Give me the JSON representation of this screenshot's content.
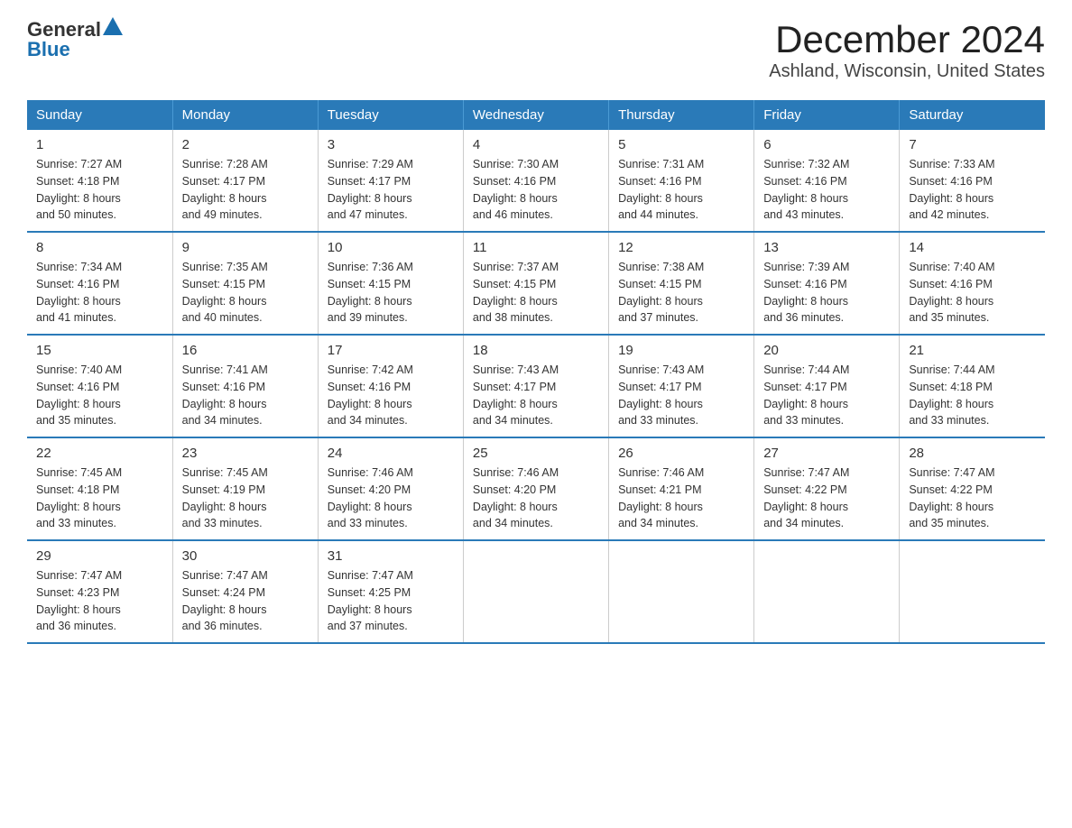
{
  "header": {
    "logo_general": "General",
    "logo_blue": "Blue",
    "month_title": "December 2024",
    "location": "Ashland, Wisconsin, United States"
  },
  "days_of_week": [
    "Sunday",
    "Monday",
    "Tuesday",
    "Wednesday",
    "Thursday",
    "Friday",
    "Saturday"
  ],
  "weeks": [
    [
      {
        "day": "1",
        "sunrise": "7:27 AM",
        "sunset": "4:18 PM",
        "daylight": "8 hours and 50 minutes."
      },
      {
        "day": "2",
        "sunrise": "7:28 AM",
        "sunset": "4:17 PM",
        "daylight": "8 hours and 49 minutes."
      },
      {
        "day": "3",
        "sunrise": "7:29 AM",
        "sunset": "4:17 PM",
        "daylight": "8 hours and 47 minutes."
      },
      {
        "day": "4",
        "sunrise": "7:30 AM",
        "sunset": "4:16 PM",
        "daylight": "8 hours and 46 minutes."
      },
      {
        "day": "5",
        "sunrise": "7:31 AM",
        "sunset": "4:16 PM",
        "daylight": "8 hours and 44 minutes."
      },
      {
        "day": "6",
        "sunrise": "7:32 AM",
        "sunset": "4:16 PM",
        "daylight": "8 hours and 43 minutes."
      },
      {
        "day": "7",
        "sunrise": "7:33 AM",
        "sunset": "4:16 PM",
        "daylight": "8 hours and 42 minutes."
      }
    ],
    [
      {
        "day": "8",
        "sunrise": "7:34 AM",
        "sunset": "4:16 PM",
        "daylight": "8 hours and 41 minutes."
      },
      {
        "day": "9",
        "sunrise": "7:35 AM",
        "sunset": "4:15 PM",
        "daylight": "8 hours and 40 minutes."
      },
      {
        "day": "10",
        "sunrise": "7:36 AM",
        "sunset": "4:15 PM",
        "daylight": "8 hours and 39 minutes."
      },
      {
        "day": "11",
        "sunrise": "7:37 AM",
        "sunset": "4:15 PM",
        "daylight": "8 hours and 38 minutes."
      },
      {
        "day": "12",
        "sunrise": "7:38 AM",
        "sunset": "4:15 PM",
        "daylight": "8 hours and 37 minutes."
      },
      {
        "day": "13",
        "sunrise": "7:39 AM",
        "sunset": "4:16 PM",
        "daylight": "8 hours and 36 minutes."
      },
      {
        "day": "14",
        "sunrise": "7:40 AM",
        "sunset": "4:16 PM",
        "daylight": "8 hours and 35 minutes."
      }
    ],
    [
      {
        "day": "15",
        "sunrise": "7:40 AM",
        "sunset": "4:16 PM",
        "daylight": "8 hours and 35 minutes."
      },
      {
        "day": "16",
        "sunrise": "7:41 AM",
        "sunset": "4:16 PM",
        "daylight": "8 hours and 34 minutes."
      },
      {
        "day": "17",
        "sunrise": "7:42 AM",
        "sunset": "4:16 PM",
        "daylight": "8 hours and 34 minutes."
      },
      {
        "day": "18",
        "sunrise": "7:43 AM",
        "sunset": "4:17 PM",
        "daylight": "8 hours and 34 minutes."
      },
      {
        "day": "19",
        "sunrise": "7:43 AM",
        "sunset": "4:17 PM",
        "daylight": "8 hours and 33 minutes."
      },
      {
        "day": "20",
        "sunrise": "7:44 AM",
        "sunset": "4:17 PM",
        "daylight": "8 hours and 33 minutes."
      },
      {
        "day": "21",
        "sunrise": "7:44 AM",
        "sunset": "4:18 PM",
        "daylight": "8 hours and 33 minutes."
      }
    ],
    [
      {
        "day": "22",
        "sunrise": "7:45 AM",
        "sunset": "4:18 PM",
        "daylight": "8 hours and 33 minutes."
      },
      {
        "day": "23",
        "sunrise": "7:45 AM",
        "sunset": "4:19 PM",
        "daylight": "8 hours and 33 minutes."
      },
      {
        "day": "24",
        "sunrise": "7:46 AM",
        "sunset": "4:20 PM",
        "daylight": "8 hours and 33 minutes."
      },
      {
        "day": "25",
        "sunrise": "7:46 AM",
        "sunset": "4:20 PM",
        "daylight": "8 hours and 34 minutes."
      },
      {
        "day": "26",
        "sunrise": "7:46 AM",
        "sunset": "4:21 PM",
        "daylight": "8 hours and 34 minutes."
      },
      {
        "day": "27",
        "sunrise": "7:47 AM",
        "sunset": "4:22 PM",
        "daylight": "8 hours and 34 minutes."
      },
      {
        "day": "28",
        "sunrise": "7:47 AM",
        "sunset": "4:22 PM",
        "daylight": "8 hours and 35 minutes."
      }
    ],
    [
      {
        "day": "29",
        "sunrise": "7:47 AM",
        "sunset": "4:23 PM",
        "daylight": "8 hours and 36 minutes."
      },
      {
        "day": "30",
        "sunrise": "7:47 AM",
        "sunset": "4:24 PM",
        "daylight": "8 hours and 36 minutes."
      },
      {
        "day": "31",
        "sunrise": "7:47 AM",
        "sunset": "4:25 PM",
        "daylight": "8 hours and 37 minutes."
      },
      null,
      null,
      null,
      null
    ]
  ],
  "labels": {
    "sunrise": "Sunrise:",
    "sunset": "Sunset:",
    "daylight": "Daylight:"
  }
}
